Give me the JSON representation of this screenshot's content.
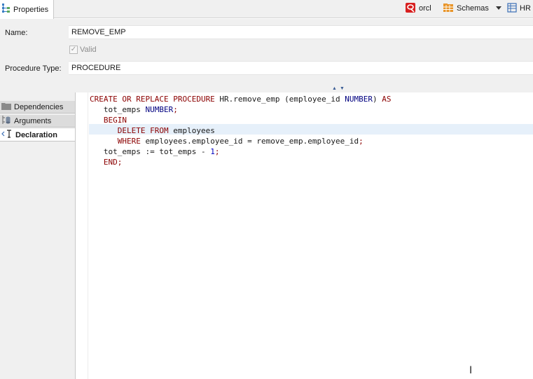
{
  "toolbar": {
    "tab_label": "Properties",
    "connection": "orcl",
    "schemas_label": "Schemas",
    "schema_value": "HR"
  },
  "properties": {
    "name_label": "Name:",
    "name_value": "REMOVE_EMP",
    "valid_label": "Valid",
    "valid_checked": true,
    "type_label": "Procedure Type:",
    "type_value": "PROCEDURE"
  },
  "nav": {
    "items": [
      {
        "label": "Dependencies",
        "icon": "folder-icon"
      },
      {
        "label": "Arguments",
        "icon": "arguments-icon"
      },
      {
        "label": "Declaration",
        "icon": "declaration-icon"
      }
    ],
    "active": "Declaration"
  },
  "code": {
    "l1_kw1": "CREATE OR REPLACE PROCEDURE",
    "l1_name": " HR.remove_emp (employee_id ",
    "l1_type": "NUMBER",
    "l1_close": ") ",
    "l1_kw2": "AS",
    "l2_var": "   tot_emps ",
    "l2_type": "NUMBER",
    "l2_end": ";",
    "l3_kw": "   BEGIN",
    "l4_kw": "      DELETE FROM",
    "l4_rest": " employees",
    "l5_kw": "      WHERE",
    "l5_rest": " employees.employee_id = remove_emp.employee_id",
    "l5_end": ";",
    "l6_pre": "   tot_emps := tot_emps - ",
    "l6_num": "1",
    "l6_end": ";",
    "l7_kw": "   END",
    "l7_end": ";"
  },
  "colors": {
    "keyword": "#8b0000",
    "type": "#000080",
    "number": "#0000c0",
    "connection_icon": "#d82020",
    "schemas_icon": "#e8952a",
    "hr_icon": "#3b6fb6"
  }
}
